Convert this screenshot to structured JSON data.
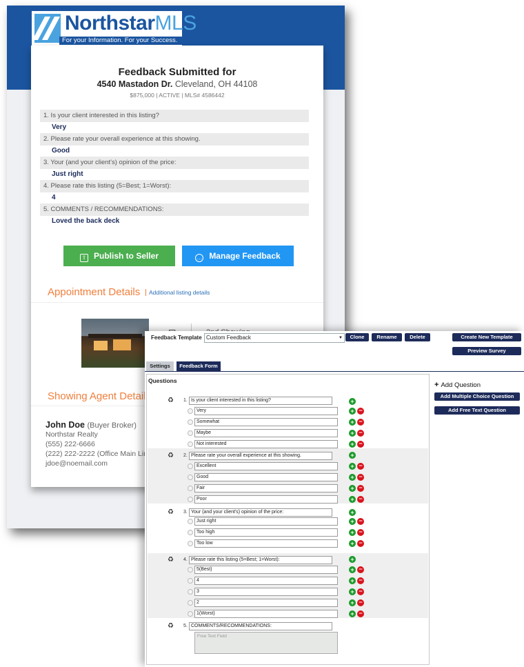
{
  "email": {
    "logo": {
      "name_bold": "Northstar",
      "name_light": "MLS",
      "tagline": "For your Information. For your Success."
    },
    "title": "Feedback Submitted for",
    "address_street": "4540 Mastadon Dr.",
    "address_city": "Cleveland, OH 44108",
    "meta": "$875,000 | ACTIVE | MLS# 4586442",
    "qa": [
      {
        "q": "1. Is your client interested in this listing?",
        "a": "Very"
      },
      {
        "q": "2. Please rate your overall experience at this showing.",
        "a": "Good"
      },
      {
        "q": "3. Your (and your client's) opinion of the price:",
        "a": "Just right"
      },
      {
        "q": "4. Please rate this listing (5=Best; 1=Worst):",
        "a": "4"
      },
      {
        "q": "5. COMMENTS / RECOMMENDATIONS:",
        "a": "Loved the back deck"
      }
    ],
    "publish_label": "Publish to Seller",
    "manage_label": "Manage Feedback",
    "appointment_title": "Appointment Details",
    "appointment_link": "Additional listing details",
    "showing_label": "2nd Showing",
    "agent_section_title": "Showing Agent Details",
    "agent": {
      "name": "John Doe",
      "role": "(Buyer Broker)",
      "company": "Northstar Realty",
      "phone": "(555) 222-6666",
      "office_phone": "(222) 222-2222 (Office Main Line)",
      "email": "jdoe@noemail.com"
    }
  },
  "editor": {
    "template_label": "Feedback Template",
    "template_value": "Custom Feedback",
    "clone": "Clone",
    "rename": "Rename",
    "delete": "Delete",
    "create_new": "Create New Template",
    "preview": "Preview Survey",
    "tab_settings": "Settings",
    "tab_form": "Feedback Form",
    "questions_title": "Questions",
    "add_question": "Add Question",
    "add_multi": "Add Multiple Choice Question",
    "add_free": "Add Free Text Question",
    "free_text_placeholder": "Free Text Field",
    "questions": [
      {
        "num": "1.",
        "text": "Is your client interested in this listing?",
        "options": [
          "Very",
          "Somewhat",
          "Maybe",
          "Not interested"
        ]
      },
      {
        "num": "2.",
        "text": "Please rate your overall experience at this showing.",
        "options": [
          "Excellent",
          "Good",
          "Fair",
          "Poor"
        ]
      },
      {
        "num": "3.",
        "text": "Your (and your client's) opinion of the price:",
        "options": [
          "Just right",
          "Too high",
          "Too low"
        ]
      },
      {
        "num": "4.",
        "text": "Please rate this listing (5=Best; 1=Worst):",
        "options": [
          "5(Best)",
          "4",
          "3",
          "2",
          "1(Worst)"
        ]
      },
      {
        "num": "5.",
        "text": "COMMENTS/RECOMMENDATIONS:"
      }
    ]
  }
}
